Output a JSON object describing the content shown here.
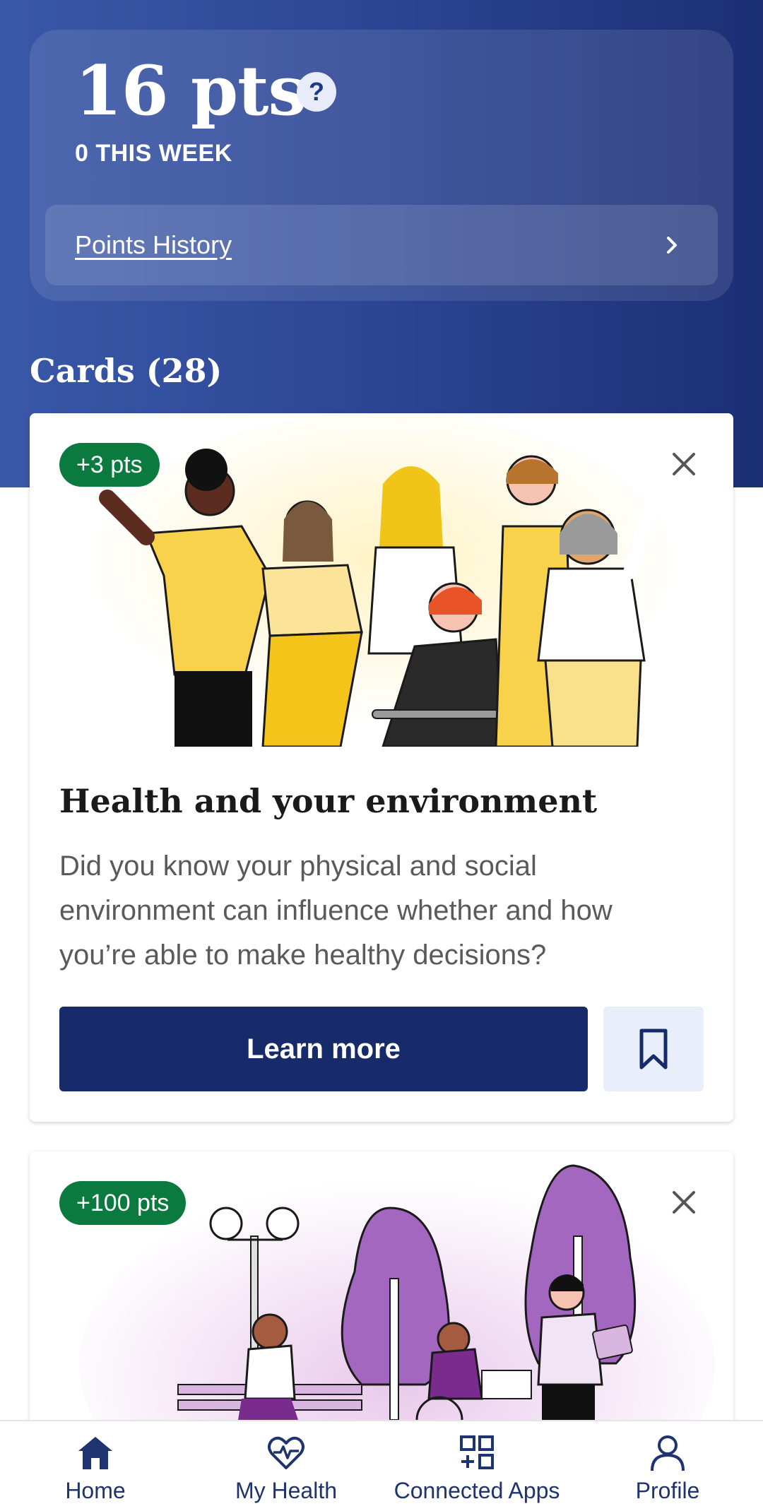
{
  "points": {
    "total": "16 pts",
    "help_icon": "question-icon",
    "this_week": "0 THIS WEEK",
    "history_label": "Points History"
  },
  "cards_heading": "Cards (28)",
  "cards": [
    {
      "badge": "+3 pts",
      "title": "Health and your environment",
      "description": "Did you know your physical and social environment can influence whether and how you’re able to make healthy decisions?",
      "cta": "Learn more"
    },
    {
      "badge": "+100 pts"
    }
  ],
  "tabbar": {
    "items": [
      {
        "label": "Home",
        "icon": "house-icon",
        "active": true
      },
      {
        "label": "My Health",
        "icon": "heart-pulse-icon"
      },
      {
        "label": "Connected Apps",
        "icon": "apps-add-icon"
      },
      {
        "label": "Profile",
        "icon": "person-icon"
      }
    ]
  },
  "colors": {
    "hero_start": "#3a58a8",
    "hero_end": "#1c2f75",
    "badge_green": "#0a7a3e",
    "primary_button": "#172b6b"
  }
}
